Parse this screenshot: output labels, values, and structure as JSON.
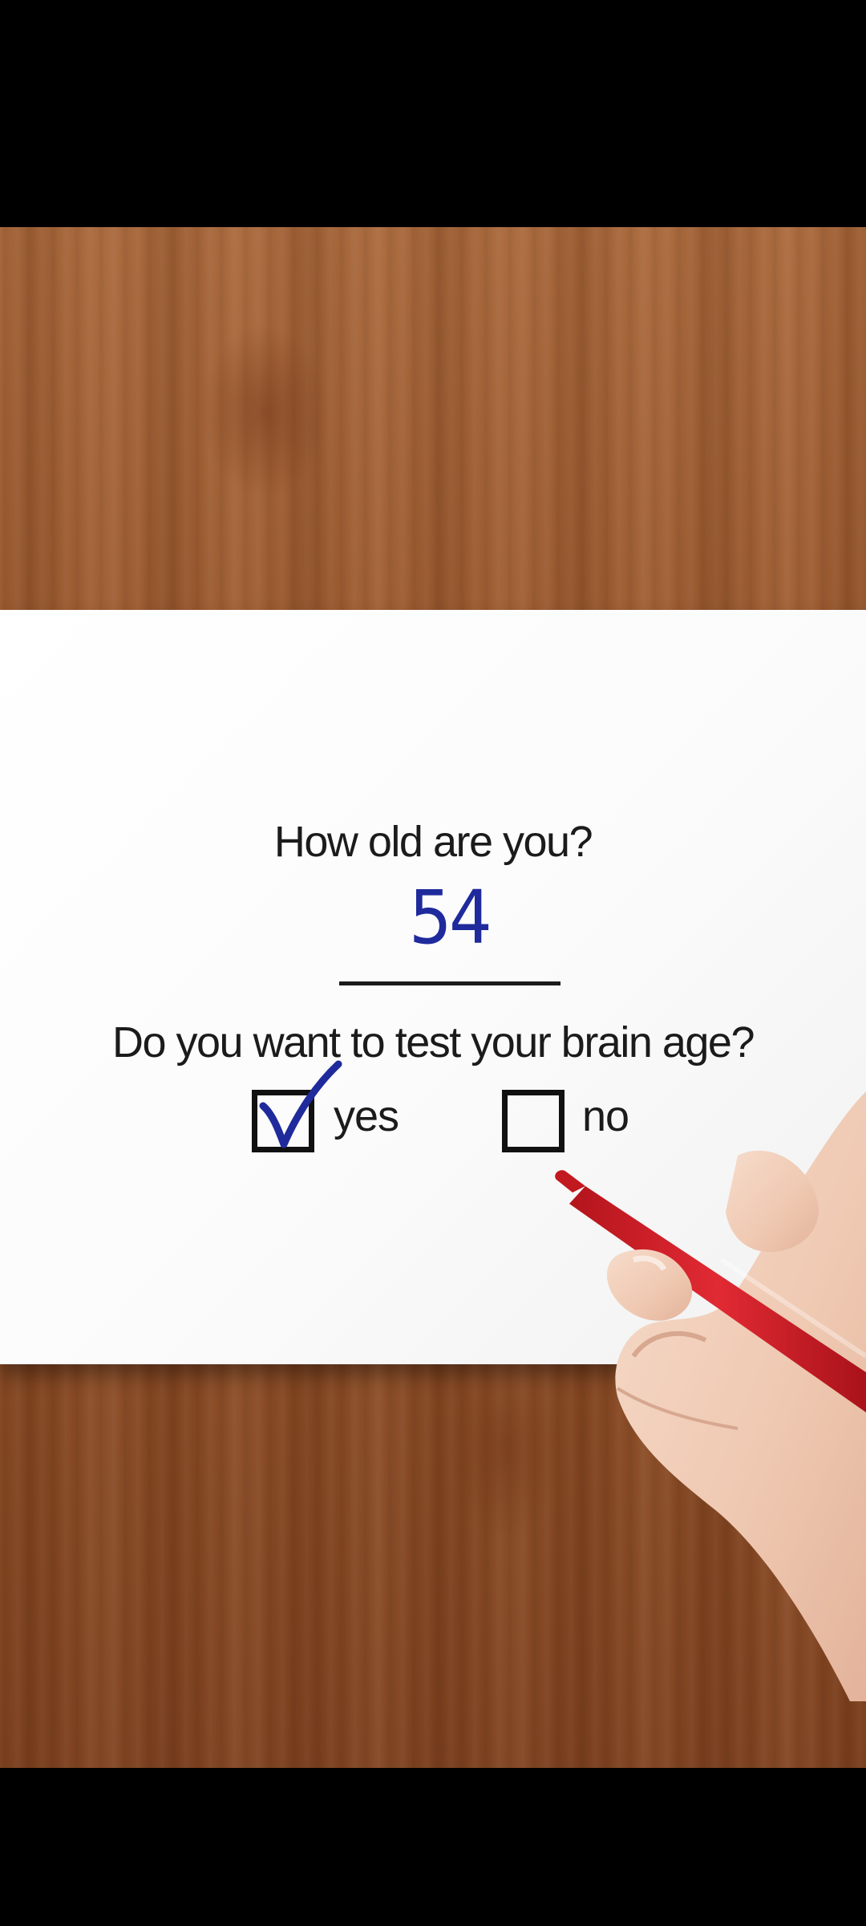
{
  "form": {
    "question_age": "How old are you?",
    "age_answer": "54",
    "question_test": "Do you want to test your brain age?",
    "options": [
      {
        "label": "yes",
        "checked": true
      },
      {
        "label": "no",
        "checked": false
      }
    ]
  },
  "colors": {
    "wood": "#9a5a30",
    "paper": "#ffffff",
    "ink": "#1f2a9c",
    "pen": "#d9202a"
  }
}
